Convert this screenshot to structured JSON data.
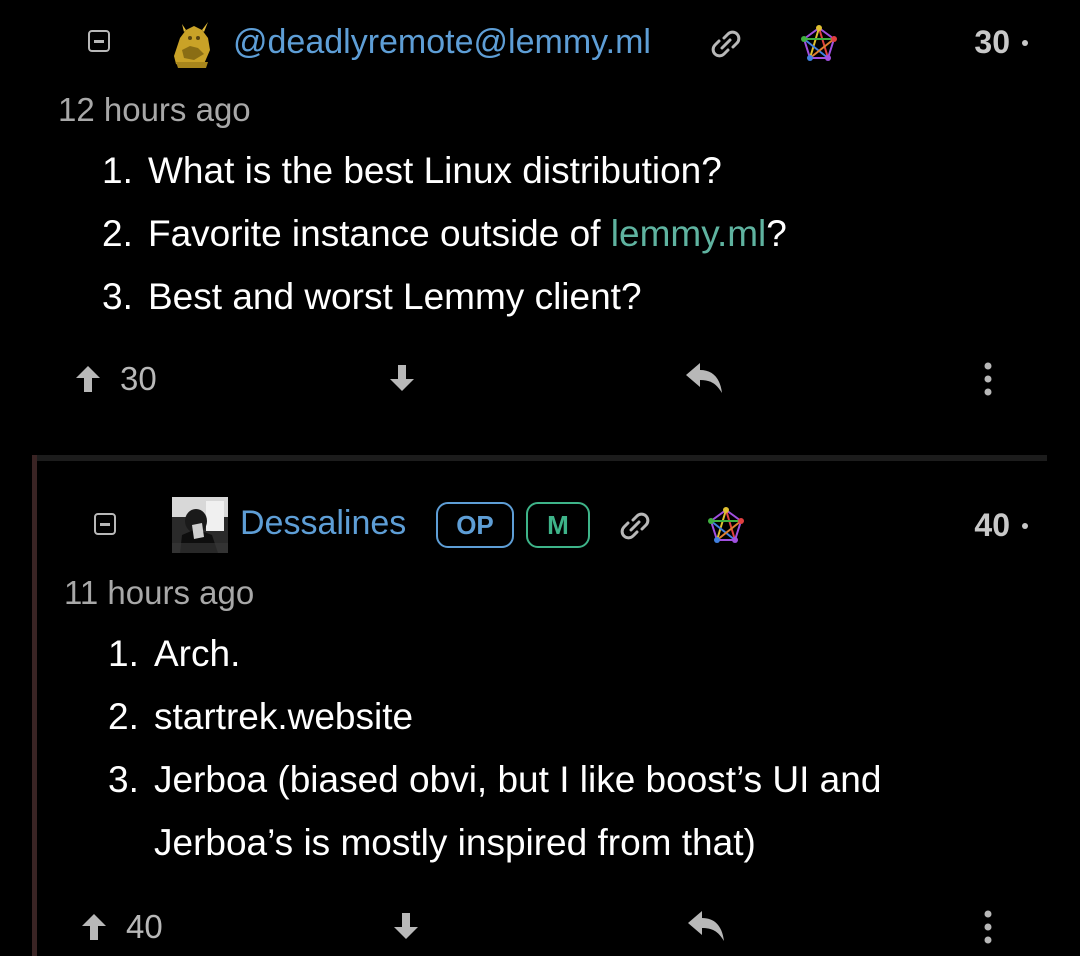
{
  "comments": [
    {
      "collapse_icon": "collapse-minus-icon",
      "avatar_icon": "golden-statue-avatar",
      "username": "@deadlyremote@lemmy.ml",
      "link_icon": "link-icon",
      "instance_icon": "fediverse-icon",
      "score": "30",
      "timestamp": "12 hours ago",
      "body_items": [
        {
          "num": "1.",
          "text": "What is the best Linux distribution?"
        },
        {
          "num": "2.",
          "text_before": "Favorite instance outside of ",
          "link": "lemmy.ml",
          "text_after": "?"
        },
        {
          "num": "3.",
          "text": "Best and worst Lemmy client?"
        }
      ],
      "upvotes": "30",
      "upvote_icon": "arrow-up-icon",
      "downvote_icon": "arrow-down-icon",
      "reply_icon": "reply-icon",
      "more_icon": "more-vertical-icon"
    },
    {
      "collapse_icon": "collapse-minus-icon",
      "avatar_icon": "photo-avatar",
      "username": "Dessalines",
      "badges": [
        "OP",
        "M"
      ],
      "link_icon": "link-icon",
      "instance_icon": "fediverse-icon",
      "score": "40",
      "timestamp": "11 hours ago",
      "body_items": [
        {
          "num": "1.",
          "text": "Arch."
        },
        {
          "num": "2.",
          "text": "startrek.website"
        },
        {
          "num": "3.",
          "text": "Jerboa (biased obvi, but I like boost’s UI and Jerboa’s is mostly inspired from that)"
        }
      ],
      "upvotes": "40",
      "upvote_icon": "arrow-up-icon",
      "downvote_icon": "arrow-down-icon",
      "reply_icon": "reply-icon",
      "more_icon": "more-vertical-icon"
    }
  ],
  "colors": {
    "background": "#000000",
    "username": "#5e9ed6",
    "mod_badge": "#3eb489",
    "link": "#5fb3a0",
    "muted": "#a8a8a8"
  }
}
